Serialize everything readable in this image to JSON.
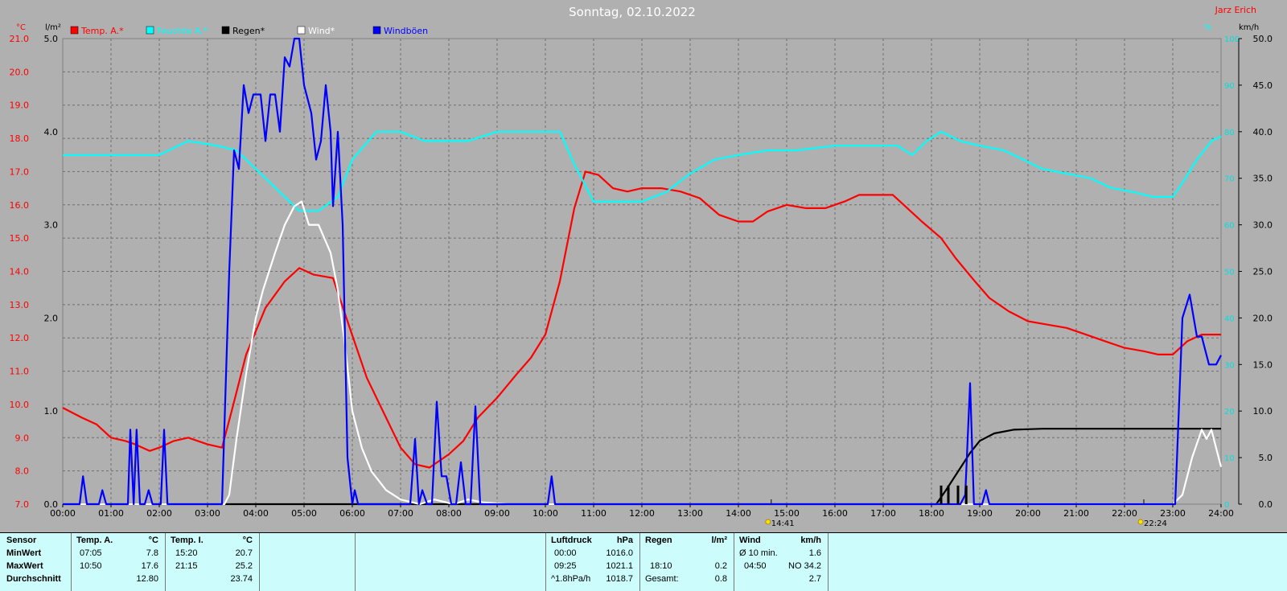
{
  "title": "Sonntag, 02.10.2022",
  "author": "Jarz Erich",
  "axes": {
    "left_temp_unit": "°C",
    "left_rain_unit": "l/m²",
    "right_hum_unit": "%",
    "right_wind_unit": "km/h"
  },
  "legend": [
    {
      "label": "Temp. A.*",
      "color": "#ff0000"
    },
    {
      "label": "Feuchte A.*",
      "color": "#00ffff"
    },
    {
      "label": "Regen*",
      "color": "#000000"
    },
    {
      "label": "Wind*",
      "color": "#ffffff"
    },
    {
      "label": "Windböen",
      "color": "#0000ff"
    }
  ],
  "markers": [
    {
      "label": "14:41",
      "hour": 14.68
    },
    {
      "label": "22:24",
      "hour": 22.4
    }
  ],
  "chart_data": {
    "type": "line",
    "x_ticks": [
      "00:00",
      "01:00",
      "02:00",
      "03:00",
      "04:00",
      "05:00",
      "06:00",
      "07:00",
      "08:00",
      "09:00",
      "10:00",
      "11:00",
      "12:00",
      "13:00",
      "14:00",
      "15:00",
      "16:00",
      "17:00",
      "18:00",
      "19:00",
      "20:00",
      "21:00",
      "22:00",
      "23:00",
      "24:00"
    ],
    "xlim": [
      0,
      24
    ],
    "y_temp_ticks": [
      "7.0",
      "8.0",
      "9.0",
      "10.0",
      "11.0",
      "12.0",
      "13.0",
      "14.0",
      "15.0",
      "16.0",
      "17.0",
      "18.0",
      "19.0",
      "20.0",
      "21.0"
    ],
    "y_temp_lim": [
      7,
      21
    ],
    "y_rain_ticks": [
      "0.0",
      "1.0",
      "2.0",
      "3.0",
      "4.0",
      "5.0"
    ],
    "y_rain_lim": [
      0,
      5
    ],
    "y_hum_ticks": [
      "0",
      "10",
      "20",
      "30",
      "40",
      "50",
      "60",
      "70",
      "80",
      "90",
      "100"
    ],
    "y_hum_lim": [
      0,
      100
    ],
    "y_wind_ticks": [
      "0.0",
      "5.0",
      "10.0",
      "15.0",
      "20.0",
      "25.0",
      "30.0",
      "35.0",
      "40.0",
      "45.0",
      "50.0"
    ],
    "y_wind_lim": [
      0,
      50
    ],
    "grid": true,
    "series": [
      {
        "name": "Temp. A.*",
        "axis": "temp",
        "color": "#ff0000",
        "points": [
          [
            0,
            9.9
          ],
          [
            0.4,
            9.6
          ],
          [
            0.7,
            9.4
          ],
          [
            1,
            9.0
          ],
          [
            1.3,
            8.9
          ],
          [
            1.5,
            8.8
          ],
          [
            1.8,
            8.6
          ],
          [
            2,
            8.7
          ],
          [
            2.3,
            8.9
          ],
          [
            2.6,
            9.0
          ],
          [
            3,
            8.8
          ],
          [
            3.3,
            8.7
          ],
          [
            3.5,
            9.8
          ],
          [
            3.8,
            11.5
          ],
          [
            4.2,
            12.9
          ],
          [
            4.6,
            13.7
          ],
          [
            4.9,
            14.1
          ],
          [
            5.2,
            13.9
          ],
          [
            5.6,
            13.8
          ],
          [
            5.9,
            12.5
          ],
          [
            6.3,
            10.8
          ],
          [
            6.7,
            9.6
          ],
          [
            7,
            8.7
          ],
          [
            7.3,
            8.2
          ],
          [
            7.6,
            8.1
          ],
          [
            8,
            8.5
          ],
          [
            8.3,
            8.9
          ],
          [
            8.6,
            9.6
          ],
          [
            9,
            10.2
          ],
          [
            9.4,
            10.9
          ],
          [
            9.7,
            11.4
          ],
          [
            10,
            12.1
          ],
          [
            10.3,
            13.7
          ],
          [
            10.6,
            15.9
          ],
          [
            10.83,
            17.0
          ],
          [
            11.1,
            16.9
          ],
          [
            11.4,
            16.5
          ],
          [
            11.7,
            16.4
          ],
          [
            12,
            16.5
          ],
          [
            12.4,
            16.5
          ],
          [
            12.8,
            16.4
          ],
          [
            13.2,
            16.2
          ],
          [
            13.6,
            15.7
          ],
          [
            14,
            15.5
          ],
          [
            14.3,
            15.5
          ],
          [
            14.6,
            15.8
          ],
          [
            15,
            16.0
          ],
          [
            15.4,
            15.9
          ],
          [
            15.8,
            15.9
          ],
          [
            16.2,
            16.1
          ],
          [
            16.5,
            16.3
          ],
          [
            16.9,
            16.3
          ],
          [
            17.2,
            16.3
          ],
          [
            17.5,
            15.9
          ],
          [
            17.8,
            15.5
          ],
          [
            18.2,
            15.0
          ],
          [
            18.5,
            14.4
          ],
          [
            18.9,
            13.7
          ],
          [
            19.2,
            13.2
          ],
          [
            19.6,
            12.8
          ],
          [
            20,
            12.5
          ],
          [
            20.4,
            12.4
          ],
          [
            20.8,
            12.3
          ],
          [
            21.2,
            12.1
          ],
          [
            21.6,
            11.9
          ],
          [
            22,
            11.7
          ],
          [
            22.4,
            11.6
          ],
          [
            22.7,
            11.5
          ],
          [
            23,
            11.5
          ],
          [
            23.3,
            11.9
          ],
          [
            23.6,
            12.1
          ],
          [
            24,
            12.1
          ]
        ]
      },
      {
        "name": "Feuchte A.*",
        "axis": "hum",
        "color": "#00ffff",
        "points": [
          [
            0,
            75
          ],
          [
            0.5,
            75
          ],
          [
            0.8,
            75
          ],
          [
            1.3,
            75
          ],
          [
            2,
            75
          ],
          [
            2.6,
            78
          ],
          [
            3.2,
            77
          ],
          [
            3.6,
            76
          ],
          [
            4.1,
            71
          ],
          [
            4.5,
            67
          ],
          [
            4.9,
            63
          ],
          [
            5.3,
            63
          ],
          [
            5.7,
            66
          ],
          [
            6,
            74
          ],
          [
            6.5,
            80
          ],
          [
            7,
            80
          ],
          [
            7.5,
            78
          ],
          [
            7.9,
            78
          ],
          [
            8.4,
            78
          ],
          [
            9,
            80
          ],
          [
            9.5,
            80
          ],
          [
            9.9,
            80
          ],
          [
            10.3,
            80
          ],
          [
            10.6,
            73
          ],
          [
            11,
            65
          ],
          [
            11.4,
            65
          ],
          [
            12,
            65
          ],
          [
            12.5,
            67
          ],
          [
            13,
            71
          ],
          [
            13.5,
            74
          ],
          [
            14,
            75
          ],
          [
            14.6,
            76
          ],
          [
            15.2,
            76
          ],
          [
            16,
            77
          ],
          [
            16.7,
            77
          ],
          [
            17.3,
            77
          ],
          [
            17.6,
            75
          ],
          [
            17.9,
            78
          ],
          [
            18.2,
            80
          ],
          [
            18.6,
            78
          ],
          [
            19,
            77
          ],
          [
            19.5,
            76
          ],
          [
            19.9,
            74
          ],
          [
            20.3,
            72
          ],
          [
            20.8,
            71
          ],
          [
            21.3,
            70
          ],
          [
            21.7,
            68
          ],
          [
            22.2,
            67
          ],
          [
            22.6,
            66
          ],
          [
            23,
            66
          ],
          [
            23.2,
            69
          ],
          [
            23.5,
            74
          ],
          [
            23.8,
            78
          ],
          [
            24,
            79
          ]
        ]
      },
      {
        "name": "Regen*",
        "axis": "rain",
        "color": "#000000",
        "points": [
          [
            0,
            0
          ],
          [
            18.1,
            0
          ],
          [
            18.3,
            0.15
          ],
          [
            18.55,
            0.35
          ],
          [
            18.8,
            0.55
          ],
          [
            19.0,
            0.68
          ],
          [
            19.3,
            0.76
          ],
          [
            19.7,
            0.8
          ],
          [
            20.3,
            0.81
          ],
          [
            24,
            0.81
          ]
        ]
      },
      {
        "name": "Wind*",
        "axis": "wind",
        "color": "#ffffff",
        "points": [
          [
            0,
            0
          ],
          [
            3.35,
            0
          ],
          [
            3.45,
            1
          ],
          [
            3.6,
            7
          ],
          [
            3.8,
            14
          ],
          [
            4,
            20
          ],
          [
            4.15,
            23
          ],
          [
            4.4,
            27
          ],
          [
            4.6,
            30
          ],
          [
            4.8,
            32
          ],
          [
            4.95,
            32.5
          ],
          [
            5.1,
            30
          ],
          [
            5.3,
            30
          ],
          [
            5.55,
            27
          ],
          [
            5.7,
            23
          ],
          [
            5.85,
            17
          ],
          [
            6,
            10
          ],
          [
            6.2,
            6
          ],
          [
            6.4,
            3.5
          ],
          [
            6.7,
            1.5
          ],
          [
            7,
            0.5
          ],
          [
            7.4,
            0
          ],
          [
            7.7,
            0.5
          ],
          [
            8.1,
            0
          ],
          [
            8.4,
            0.5
          ],
          [
            8.7,
            0.2
          ],
          [
            9.2,
            0
          ],
          [
            23,
            0
          ],
          [
            23.2,
            1
          ],
          [
            23.4,
            5
          ],
          [
            23.6,
            8
          ],
          [
            23.7,
            7
          ],
          [
            23.8,
            8
          ],
          [
            23.9,
            6
          ],
          [
            24,
            4
          ]
        ]
      },
      {
        "name": "Windböen",
        "axis": "wind",
        "color": "#0000ff",
        "points": [
          [
            0,
            0
          ],
          [
            0.35,
            0
          ],
          [
            0.42,
            3
          ],
          [
            0.5,
            0
          ],
          [
            0.75,
            0
          ],
          [
            0.82,
            1.5
          ],
          [
            0.9,
            0
          ],
          [
            1.35,
            0
          ],
          [
            1.4,
            8
          ],
          [
            1.47,
            0
          ],
          [
            1.53,
            8
          ],
          [
            1.6,
            0
          ],
          [
            1.7,
            0
          ],
          [
            1.78,
            1.5
          ],
          [
            1.86,
            0
          ],
          [
            2.03,
            0
          ],
          [
            2.1,
            8
          ],
          [
            2.17,
            0
          ],
          [
            3.3,
            0
          ],
          [
            3.45,
            25
          ],
          [
            3.55,
            38
          ],
          [
            3.65,
            36
          ],
          [
            3.75,
            45
          ],
          [
            3.85,
            42
          ],
          [
            3.95,
            44
          ],
          [
            4.1,
            44
          ],
          [
            4.2,
            39
          ],
          [
            4.3,
            44
          ],
          [
            4.4,
            44
          ],
          [
            4.5,
            40
          ],
          [
            4.6,
            48
          ],
          [
            4.7,
            47
          ],
          [
            4.8,
            50
          ],
          [
            4.9,
            50
          ],
          [
            5,
            45
          ],
          [
            5.15,
            42
          ],
          [
            5.25,
            37
          ],
          [
            5.35,
            39
          ],
          [
            5.45,
            45
          ],
          [
            5.55,
            40
          ],
          [
            5.6,
            32
          ],
          [
            5.7,
            40
          ],
          [
            5.8,
            30
          ],
          [
            5.9,
            5
          ],
          [
            6,
            0
          ],
          [
            6.05,
            1.5
          ],
          [
            6.12,
            0
          ],
          [
            7.2,
            0
          ],
          [
            7.3,
            7
          ],
          [
            7.38,
            0
          ],
          [
            7.45,
            1.5
          ],
          [
            7.55,
            0
          ],
          [
            7.65,
            0
          ],
          [
            7.75,
            11
          ],
          [
            7.85,
            3
          ],
          [
            7.95,
            3
          ],
          [
            8.05,
            0
          ],
          [
            8.15,
            0
          ],
          [
            8.25,
            4.5
          ],
          [
            8.35,
            0
          ],
          [
            8.45,
            0
          ],
          [
            8.55,
            10.5
          ],
          [
            8.65,
            0
          ],
          [
            10.05,
            0
          ],
          [
            10.13,
            3
          ],
          [
            10.2,
            0
          ],
          [
            18.6,
            0
          ],
          [
            18.7,
            1
          ],
          [
            18.8,
            13
          ],
          [
            18.88,
            0
          ],
          [
            19.05,
            0
          ],
          [
            19.13,
            1.5
          ],
          [
            19.2,
            0
          ],
          [
            23.05,
            0
          ],
          [
            23.2,
            20
          ],
          [
            23.35,
            22.5
          ],
          [
            23.5,
            18
          ],
          [
            23.6,
            18
          ],
          [
            23.75,
            15
          ],
          [
            23.9,
            15
          ],
          [
            24,
            16
          ]
        ]
      },
      {
        "name": "Regen*",
        "axis": "rain",
        "type": "bar",
        "color": "#000000",
        "points": [
          [
            18.2,
            0.2
          ],
          [
            18.35,
            0.2
          ],
          [
            18.55,
            0.2
          ],
          [
            18.72,
            0.2
          ]
        ]
      }
    ]
  },
  "footer": {
    "sensor": {
      "header": "Sensor",
      "rows": [
        "MinWert",
        "MaxWert",
        "Durchschnitt"
      ]
    },
    "temp_a": {
      "header": "Temp. A.",
      "unit": "°C",
      "rows": [
        {
          "time": "07:05",
          "value": "7.8"
        },
        {
          "time": "10:50",
          "value": "17.6"
        },
        {
          "time": "",
          "value": "12.80"
        }
      ]
    },
    "temp_i": {
      "header": "Temp. I.",
      "unit": "°C",
      "rows": [
        {
          "time": "15:20",
          "value": "20.7"
        },
        {
          "time": "21:15",
          "value": "25.2"
        },
        {
          "time": "",
          "value": "23.74"
        }
      ]
    },
    "luftdruck": {
      "header": "Luftdruck",
      "unit": "hPa",
      "rows": [
        {
          "time": "00:00",
          "value": "1016.0"
        },
        {
          "time": "09:25",
          "value": "1021.1"
        },
        {
          "time": "^1.8hPa/h",
          "value": "1018.7"
        }
      ]
    },
    "regen": {
      "header": "Regen",
      "unit": "l/m²",
      "rows": [
        {
          "time": "",
          "value": ""
        },
        {
          "time": "18:10",
          "value": "0.2"
        },
        {
          "time": "Gesamt:",
          "value": "0.8"
        }
      ]
    },
    "wind": {
      "header": "Wind",
      "unit": "km/h",
      "rows": [
        {
          "time": "Ø 10 min.",
          "value": "1.6"
        },
        {
          "time": "04:50",
          "value": "NO 34.2"
        },
        {
          "time": "",
          "value": "2.7"
        }
      ]
    }
  }
}
